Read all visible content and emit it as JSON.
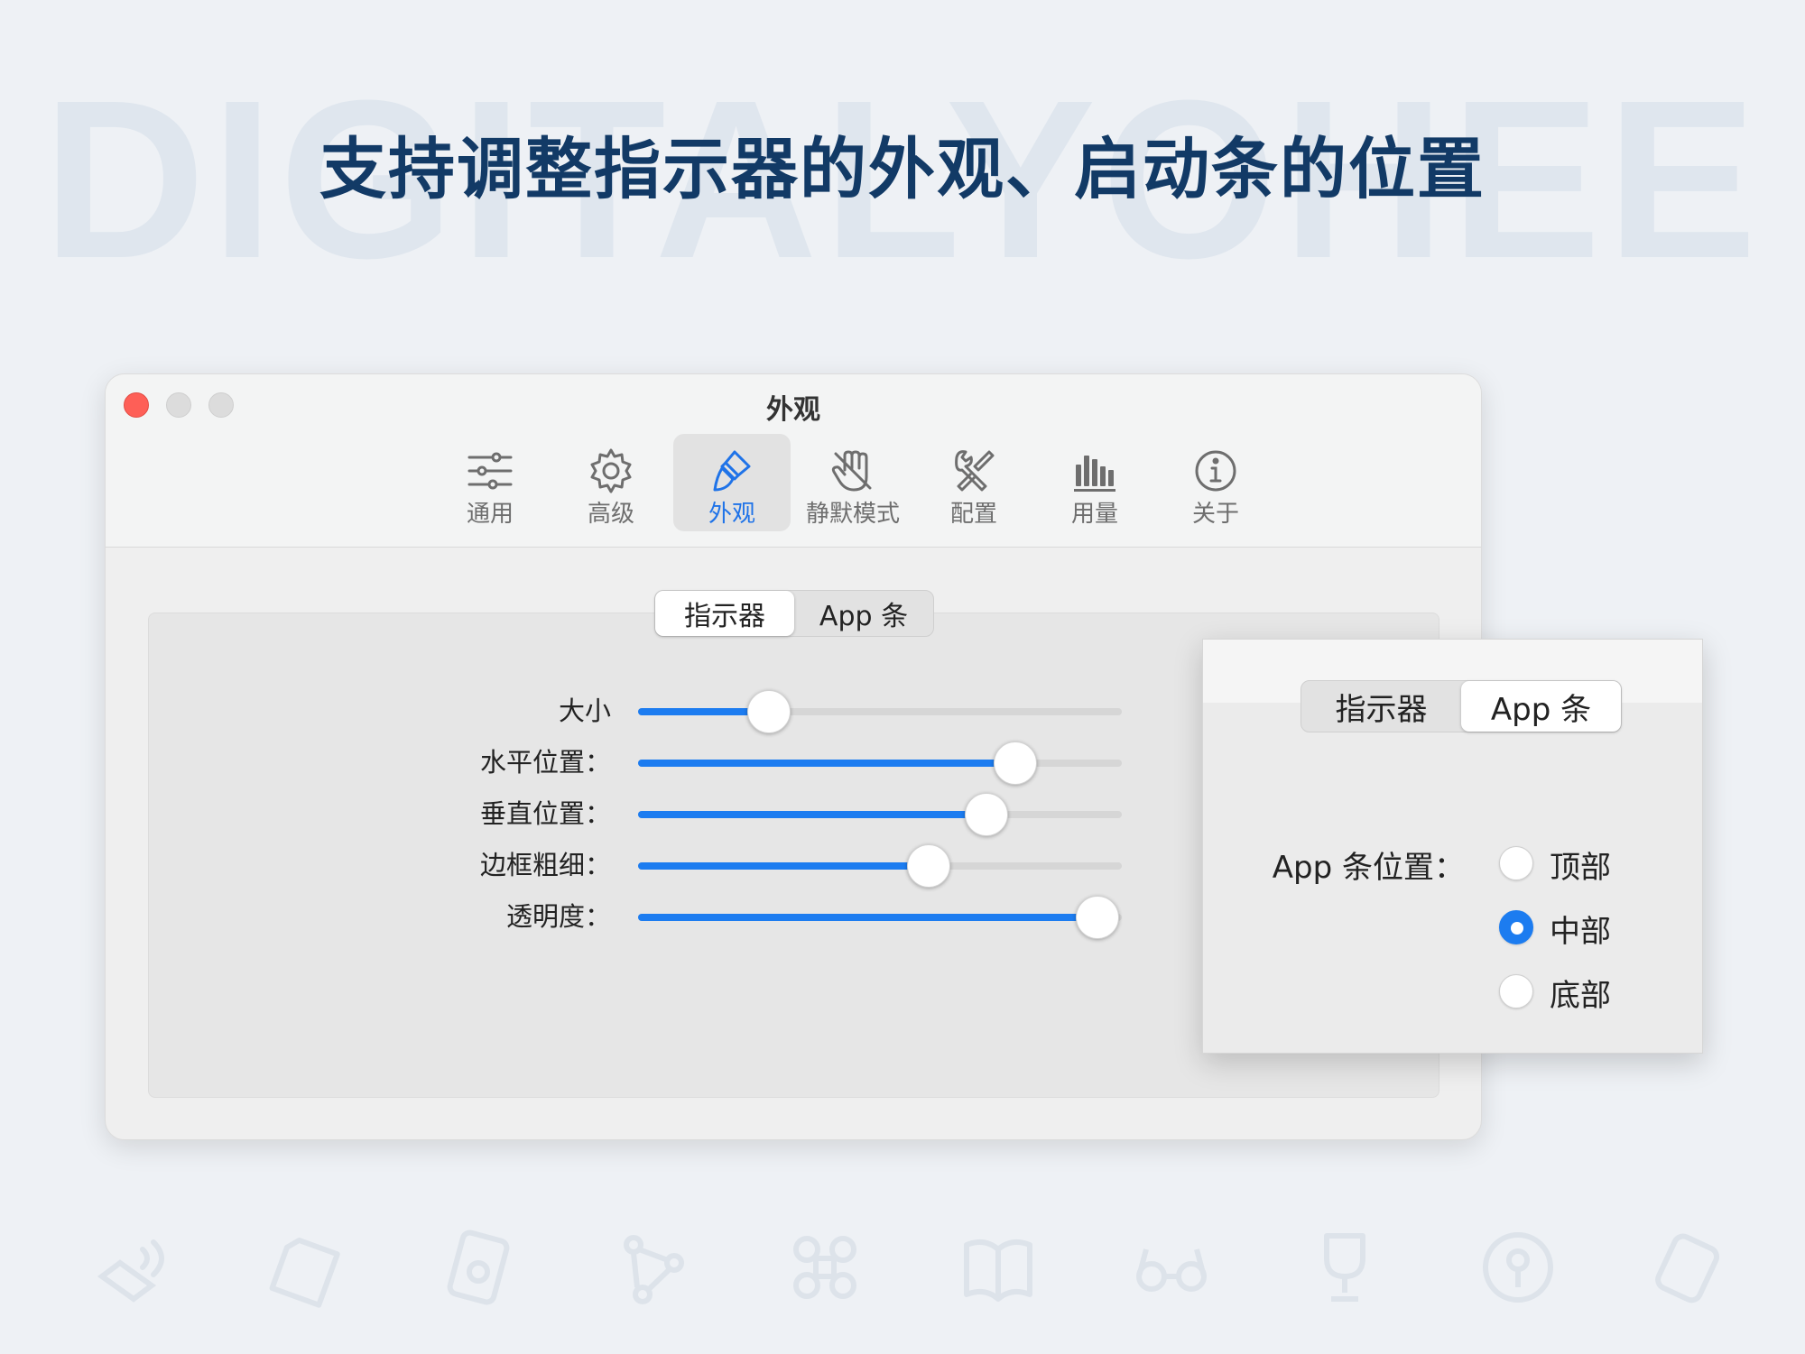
{
  "watermark": "DIGITALYOHEE",
  "headline": "支持调整指示器的外观、启动条的位置",
  "window": {
    "title": "外观",
    "toolbar": [
      {
        "label": "通用",
        "icon": "sliders-icon"
      },
      {
        "label": "高级",
        "icon": "gear-icon"
      },
      {
        "label": "外观",
        "icon": "paintbrush-icon",
        "active": true
      },
      {
        "label": "静默模式",
        "icon": "hand-slash-icon"
      },
      {
        "label": "配置",
        "icon": "wrench-screwdriver-icon"
      },
      {
        "label": "用量",
        "icon": "bar-chart-icon"
      },
      {
        "label": "关于",
        "icon": "info-circle-icon"
      }
    ],
    "segment": {
      "options": [
        "指示器",
        "App 条"
      ],
      "selected": 0
    },
    "sliders": [
      {
        "label": "大小",
        "value": 0.27
      },
      {
        "label": "水平位置：",
        "value": 0.78
      },
      {
        "label": "垂直位置：",
        "value": 0.72
      },
      {
        "label": "边框粗细：",
        "value": 0.6
      },
      {
        "label": "透明度：",
        "value": 0.95
      }
    ]
  },
  "popup": {
    "segment": {
      "options": [
        "指示器",
        "App 条"
      ],
      "selected": 1
    },
    "position_label": "App 条位置：",
    "options": [
      "顶部",
      "中部",
      "底部"
    ],
    "selected": 1
  },
  "colors": {
    "accent": "#1c7cf0",
    "headline": "#123a66",
    "close": "#fe5f57",
    "background": "#eef1f5"
  }
}
